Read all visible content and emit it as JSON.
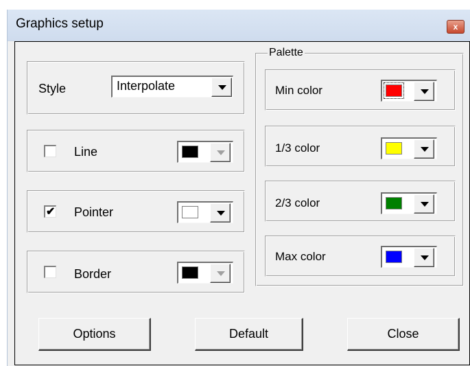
{
  "window": {
    "title": "Graphics setup",
    "close_glyph": "x"
  },
  "style": {
    "label": "Style",
    "value": "Interpolate"
  },
  "line": {
    "label": "Line",
    "checked": false,
    "checkmark": "",
    "color": "#000000",
    "enabled": false
  },
  "pointer": {
    "label": "Pointer",
    "checked": true,
    "checkmark": "✔",
    "color": "#ffffff",
    "enabled": true
  },
  "border": {
    "label": "Border",
    "checked": false,
    "checkmark": "",
    "color": "#000000",
    "enabled": false
  },
  "palette": {
    "title": "Palette",
    "min_label": "Min color",
    "min_color": "#ff0000",
    "third_label": "1/3 color",
    "third_color": "#ffff00",
    "twothird_label": "2/3 color",
    "twothird_color": "#008000",
    "max_label": "Max color",
    "max_color": "#0000ff"
  },
  "buttons": {
    "options": "Options",
    "default": "Default",
    "close": "Close"
  }
}
